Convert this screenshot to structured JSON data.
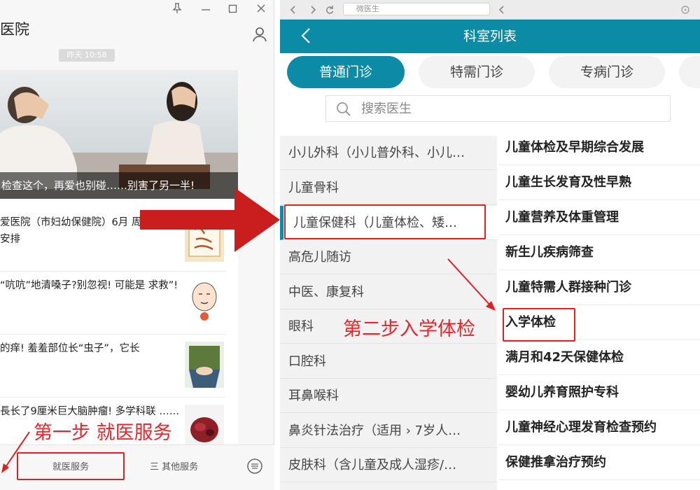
{
  "left_window": {
    "title": "医院",
    "time_label": "昨天 10:58",
    "window_controls": [
      "pin-icon",
      "minimize-icon",
      "maximize-icon",
      "close-icon"
    ],
    "hero_caption": "检查这个，再爱也别碰……别害了另一半!",
    "news": [
      {
        "text": "爱医院（市妇幼保健院）6月 周末门诊安排",
        "thumb": "calendar-thumbnail"
      },
      {
        "text": "“吭吭”地清嗓子?别忽视! 可能是 求救”!",
        "thumb": "sore-throat-thumbnail"
      },
      {
        "text": "的痒! 羞羞部位长“虫子”，它长",
        "thumb": "itch-thumbnail"
      },
      {
        "text": "長长了9厘米巨大脑肿瘤! 多学科联 ……",
        "thumb": "brain-tumor-thumbnail"
      }
    ],
    "bottom_tabs": [
      "就医服务",
      "三 其他服务"
    ]
  },
  "right_window": {
    "address_text": "微医生",
    "header_title": "科室列表",
    "tabs": [
      "普通门诊",
      "特需门诊",
      "专病门诊"
    ],
    "active_tab": 0,
    "search_placeholder": "搜索医生",
    "departments": [
      "小儿外科（小儿普外科、小儿…",
      "儿童骨科",
      "儿童保健科（儿童体检、矮…",
      "高危儿随访",
      "中医、康复科",
      "眼科",
      "口腔科",
      "耳鼻喉科",
      "鼻炎针法治疗（适用 › 7岁人…",
      "皮肤科（含儿童及成人湿疹/…"
    ],
    "active_department": 2,
    "sub_departments": [
      "儿童体检及早期综合发展",
      "儿童生长发育及性早熟",
      "儿童营养及体重管理",
      "新生儿疾病筛查",
      "儿童特需人群接种门诊",
      "入学体检",
      "满月和42天保健体检",
      "婴幼儿养育照护专科",
      "儿童神经心理发育检查预约",
      "保健推拿治疗预约"
    ]
  },
  "annotations": {
    "step1": "第一步 就医服务",
    "step2": "第二步入学体检"
  },
  "colors": {
    "accent": "#0b8ba5",
    "annotation_red": "#e02020"
  }
}
